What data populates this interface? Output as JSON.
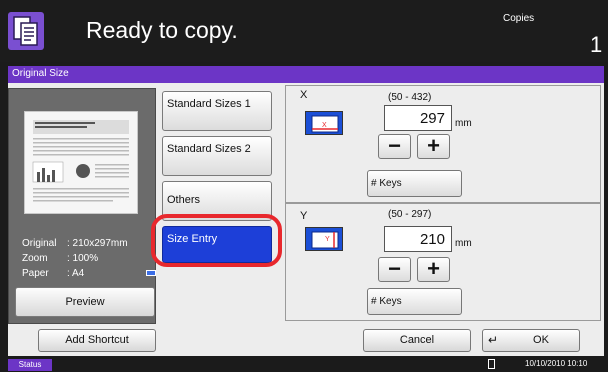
{
  "header": {
    "status_message": "Ready to copy.",
    "copies_label": "Copies",
    "copies_value": "1"
  },
  "panel": {
    "title": "Original Size"
  },
  "preview": {
    "original_label": "Original",
    "original_value": ": 210x297mm",
    "zoom_label": "Zoom",
    "zoom_value": ": 100%",
    "paper_label": "Paper",
    "paper_value": ": A4",
    "preview_button": "Preview"
  },
  "size_options": [
    {
      "label": "Standard Sizes 1",
      "selected": false
    },
    {
      "label": "Standard Sizes 2",
      "selected": false
    },
    {
      "label": "Others",
      "selected": false
    },
    {
      "label": "Size Entry",
      "selected": true
    }
  ],
  "x_axis": {
    "letter": "X",
    "range": "(50 - 432)",
    "value": "297",
    "unit": "mm",
    "minus": "−",
    "plus": "+",
    "keys_button": "# Keys"
  },
  "y_axis": {
    "letter": "Y",
    "range": "(50 - 297)",
    "value": "210",
    "unit": "mm",
    "minus": "−",
    "plus": "+",
    "keys_button": "# Keys"
  },
  "footer": {
    "add_shortcut": "Add Shortcut",
    "cancel": "Cancel",
    "ok": "OK"
  },
  "statusbar": {
    "status_button": "Status",
    "datetime": "10/10/2010  10:10"
  },
  "colors": {
    "accent_purple": "#6c35c6",
    "selected_blue": "#1d3fd8",
    "highlight_red": "#e8282d"
  }
}
